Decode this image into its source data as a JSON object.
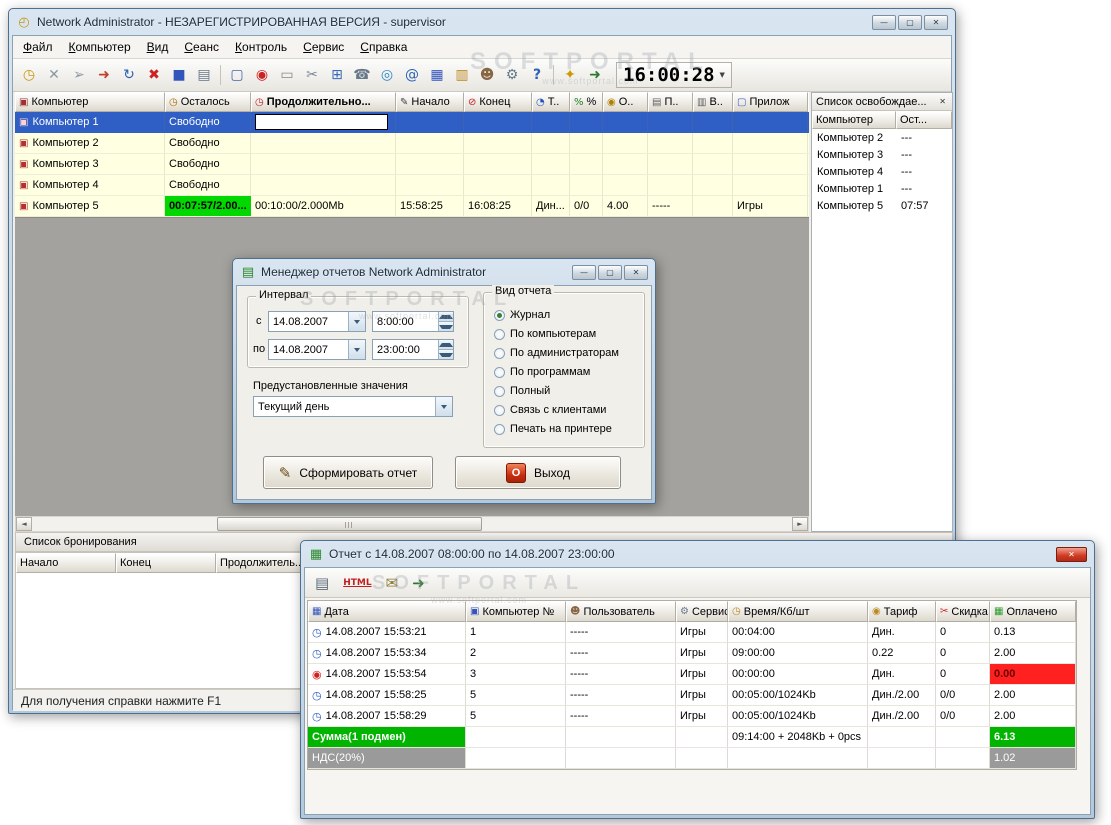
{
  "colors": {
    "selection_blue": "#2f5fc4",
    "free_time_green": "#00d800",
    "row_yellow": "#ffffe1",
    "unpaid_red": "#ff2020",
    "total_green": "#00b400",
    "vat_gray": "#9a9a9a"
  },
  "glyphs": {
    "app": "◴",
    "minimize": "—",
    "maximize": "▢",
    "close": "✕",
    "dropdown": "▼",
    "left": "◄",
    "right": "►",
    "report_doc": "▤",
    "report_grid": "▦",
    "pencil": "✎",
    "power": "O"
  },
  "watermark": {
    "brand": "SOFTPORTAL",
    "url": "www.softportal.com"
  },
  "main_window": {
    "title": "Network Administrator - НЕЗАРЕГИСТРИРОВАННАЯ ВЕРСИЯ - supervisor",
    "menu": [
      "Файл",
      "Компьютер",
      "Вид",
      "Сеанс",
      "Контроль",
      "Сервис",
      "Справка"
    ],
    "toolbar": {
      "clock": "16:00:28",
      "icons": [
        {
          "name": "session-timer-icon",
          "glyph": "◷"
        },
        {
          "name": "delete-icon",
          "glyph": "✕"
        },
        {
          "name": "send-message-icon",
          "glyph": "➢"
        },
        {
          "name": "resume-icon",
          "glyph": "➜"
        },
        {
          "name": "refresh-time-icon",
          "glyph": "↻"
        },
        {
          "name": "cancel-session-icon",
          "glyph": "✖"
        },
        {
          "name": "transfer-icon",
          "glyph": "■"
        },
        {
          "name": "print-icon",
          "glyph": "▤"
        },
        {
          "name": "monitor-icon",
          "glyph": "▢"
        },
        {
          "name": "stop-icon",
          "glyph": "◉"
        },
        {
          "name": "tariff-card-icon",
          "glyph": "▭"
        },
        {
          "name": "discount-icon",
          "glyph": "✂"
        },
        {
          "name": "network-icon",
          "glyph": "⊞"
        },
        {
          "name": "phone-icon",
          "glyph": "☎"
        },
        {
          "name": "info-icon",
          "glyph": "◎"
        },
        {
          "name": "web-icon",
          "glyph": "@"
        },
        {
          "name": "apps-icon",
          "glyph": "▦"
        },
        {
          "name": "stats-icon",
          "glyph": "▥"
        },
        {
          "name": "clients-icon",
          "glyph": "☻"
        },
        {
          "name": "settings-icon",
          "glyph": "⚙"
        },
        {
          "name": "help-icon",
          "glyph": "?"
        },
        {
          "name": "key-icon",
          "glyph": "✦"
        },
        {
          "name": "logout-icon",
          "glyph": "➜"
        }
      ]
    },
    "session_table": {
      "row_icon_glyph": "▣",
      "columns": [
        {
          "label": "Компьютер",
          "glyph": "▣"
        },
        {
          "label": "Осталось",
          "glyph": "◷"
        },
        {
          "label": "Продолжительно...",
          "glyph": "◷"
        },
        {
          "label": "Начало",
          "glyph": "✎"
        },
        {
          "label": "Конец",
          "glyph": "⊘"
        },
        {
          "label": "Т..",
          "glyph": "◔"
        },
        {
          "label": "%",
          "glyph": "%"
        },
        {
          "label": "О..",
          "glyph": "◉"
        },
        {
          "label": "П..",
          "glyph": "▤"
        },
        {
          "label": "В..",
          "glyph": "▥"
        },
        {
          "label": "Прилож",
          "glyph": "▢"
        }
      ],
      "rows": [
        {
          "cells": [
            "Компьютер 1",
            "Свободно",
            "",
            "",
            "",
            "",
            "",
            "",
            "",
            "",
            ""
          ]
        },
        {
          "cells": [
            "Компьютер 2",
            "Свободно",
            "",
            "",
            "",
            "",
            "",
            "",
            "",
            "",
            ""
          ]
        },
        {
          "cells": [
            "Компьютер 3",
            "Свободно",
            "",
            "",
            "",
            "",
            "",
            "",
            "",
            "",
            ""
          ]
        },
        {
          "cells": [
            "Компьютер 4",
            "Свободно",
            "",
            "",
            "",
            "",
            "",
            "",
            "",
            "",
            ""
          ]
        },
        {
          "cells": [
            "Компьютер 5",
            "00:07:57/2.00...",
            "00:10:00/2.000Mb",
            "15:58:25",
            "16:08:25",
            "Дин...",
            "0/0",
            "4.00",
            "-----",
            "",
            "Игры"
          ]
        }
      ]
    },
    "release_panel": {
      "title": "Список освобождае...",
      "columns": [
        "Компьютер",
        "Ост..."
      ],
      "rows": [
        [
          "Компьютер 2",
          "---"
        ],
        [
          "Компьютер 3",
          "---"
        ],
        [
          "Компьютер 4",
          "---"
        ],
        [
          "Компьютер 1",
          "---"
        ],
        [
          "Компьютер 5",
          "07:57"
        ]
      ]
    },
    "booking_panel": {
      "title": "Список бронирования",
      "columns": [
        "Начало",
        "Конец",
        "Продолжитель..."
      ]
    },
    "status_bar": "Для получения справки нажмите F1"
  },
  "report_manager_dialog": {
    "title": "Менеджер отчетов Network Administrator",
    "interval_group": {
      "label": "Интервал",
      "from_label": "с",
      "from_date": "14.08.2007",
      "from_time": "8:00:00",
      "to_label": "по",
      "to_date": "14.08.2007",
      "to_time": "23:00:00"
    },
    "presets_label": "Предустановленные значения",
    "presets_value": "Текущий день",
    "report_type_group": {
      "label": "Вид отчета",
      "options": [
        {
          "label": "Журнал",
          "selected": true
        },
        {
          "label": "По компьютерам",
          "selected": false
        },
        {
          "label": "По администраторам",
          "selected": false
        },
        {
          "label": "По программам",
          "selected": false
        },
        {
          "label": "Полный",
          "selected": false
        },
        {
          "label": "Связь с клиентами",
          "selected": false
        },
        {
          "label": "Печать на принтере",
          "selected": false
        }
      ]
    },
    "generate_button": "Сформировать отчет",
    "exit_button": "Выход"
  },
  "report_window": {
    "title": "Отчет с 14.08.2007 08:00:00 по 14.08.2007 23:00:00",
    "row_icon_glyph": "◷",
    "alert_icon_glyph": "◉",
    "toolbar": [
      {
        "name": "print-report-icon",
        "glyph": "▤"
      },
      {
        "name": "export-html-icon",
        "glyph": "HTML"
      },
      {
        "name": "email-report-icon",
        "glyph": "✉"
      },
      {
        "name": "close-report-icon",
        "glyph": "➜"
      }
    ],
    "columns": [
      {
        "label": "Дата",
        "glyph": "▦"
      },
      {
        "label": "Компьютер №",
        "glyph": "▣"
      },
      {
        "label": "Пользователь",
        "glyph": "☻"
      },
      {
        "label": "Сервис",
        "glyph": "⚙"
      },
      {
        "label": "Время/Кб/шт",
        "glyph": "◷"
      },
      {
        "label": "Тариф",
        "glyph": "◉"
      },
      {
        "label": "Скидка",
        "glyph": "✂"
      },
      {
        "label": "Оплачено",
        "glyph": "▦"
      }
    ],
    "rows": [
      {
        "alert": false,
        "cells": [
          "14.08.2007 15:53:21",
          "1",
          "-----",
          "Игры",
          "00:04:00",
          "Дин.",
          "0",
          "0.13"
        ]
      },
      {
        "alert": false,
        "cells": [
          "14.08.2007 15:53:34",
          "2",
          "-----",
          "Игры",
          "09:00:00",
          "0.22",
          "0",
          "2.00"
        ]
      },
      {
        "alert": true,
        "cells": [
          "14.08.2007 15:53:54",
          "3",
          "-----",
          "Игры",
          "00:00:00",
          "Дин.",
          "0",
          "0.00"
        ]
      },
      {
        "alert": false,
        "cells": [
          "14.08.2007 15:58:25",
          "5",
          "-----",
          "Игры",
          "00:05:00/1024Kb",
          "Дин./2.00",
          "0/0",
          "2.00"
        ]
      },
      {
        "alert": false,
        "cells": [
          "14.08.2007 15:58:29",
          "5",
          "-----",
          "Игры",
          "00:05:00/1024Kb",
          "Дин./2.00",
          "0/0",
          "2.00"
        ]
      }
    ],
    "total_row": {
      "label": "Сумма(1 подмен)",
      "time": "09:14:00 + 2048Kb + 0pcs",
      "paid": "6.13"
    },
    "vat_row": {
      "label": "НДС(20%)",
      "paid": "1.02"
    }
  }
}
